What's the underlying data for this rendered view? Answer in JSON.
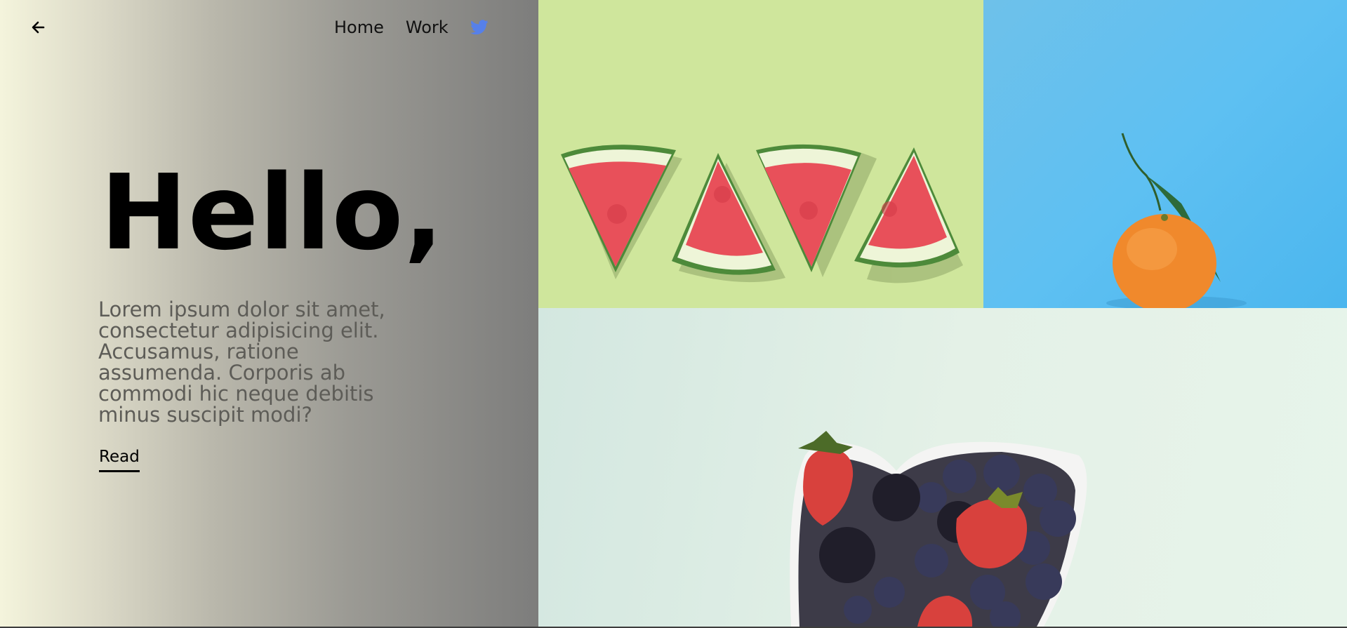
{
  "nav": {
    "back_icon": "arrow-left-icon",
    "links": [
      {
        "label": "Home"
      },
      {
        "label": "Work"
      }
    ],
    "social_icon": "twitter-icon",
    "social_color": "#5680e9"
  },
  "hero": {
    "title": "Hello,",
    "body": "Lorem ipsum dolor sit amet, consectetur adipisicing elit. Accusamus, ratione assumenda. Corporis ab commodi hic neque debitis minus suscipit modi?",
    "read_label": "Read"
  },
  "gallery": {
    "tiles": [
      {
        "subject": "watermelon-slices",
        "bg": "#cfe69c"
      },
      {
        "subject": "mandarin-orange",
        "bg": "#5ec0f2"
      },
      {
        "subject": "berry-heart-bowl",
        "bg": "#e4f1e7"
      }
    ]
  }
}
